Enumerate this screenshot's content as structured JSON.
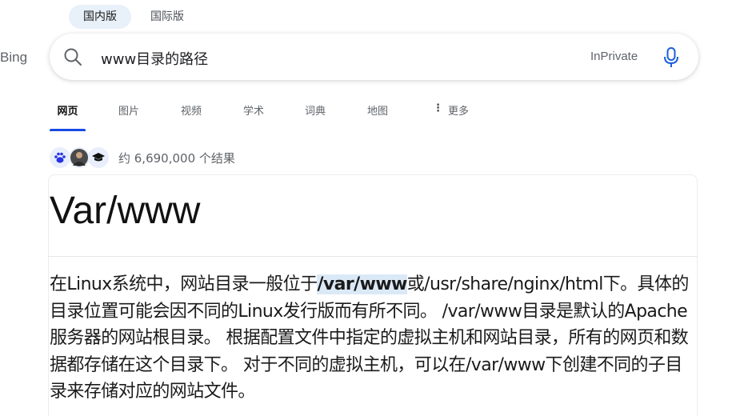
{
  "region_tabs": [
    {
      "label": "国内版",
      "active": true
    },
    {
      "label": "国际版",
      "active": false
    }
  ],
  "logo_text": "Bing",
  "search": {
    "query": "www目录的路径",
    "inprivate_label": "InPrivate"
  },
  "nav": {
    "items": [
      {
        "label": "网页",
        "active": true
      },
      {
        "label": "图片"
      },
      {
        "label": "视频"
      },
      {
        "label": "学术"
      },
      {
        "label": "词典"
      },
      {
        "label": "地图"
      },
      {
        "label": "更多",
        "icon": "more-vertical-icon"
      }
    ]
  },
  "results": {
    "count_text": "约 6,690,000 个结果",
    "source_icons": [
      "baidu-paw-icon",
      "avatar-photo",
      "graduation-cap-icon"
    ]
  },
  "answer": {
    "title": "Var/www",
    "body_before": "在Linux系统中，网站目录一般位于",
    "body_highlight": "/var/www",
    "body_after": "或/usr/share/nginx/html下。具体的目录位置可能会因不同的Linux发行版而有所不同。 /var/www目录是默认的Apache服务器的网站根目录。 根据配置文件中指定的虚拟主机和网站目录，所有的网页和数据都存储在这个目录下。 对于不同的虚拟主机，可以在/var/www下创建不同的子目录来存储对应的网站文件。"
  },
  "colors": {
    "accent": "#174ae4",
    "highlight": "#dbe9f7",
    "mic": "#1a5fd8"
  }
}
